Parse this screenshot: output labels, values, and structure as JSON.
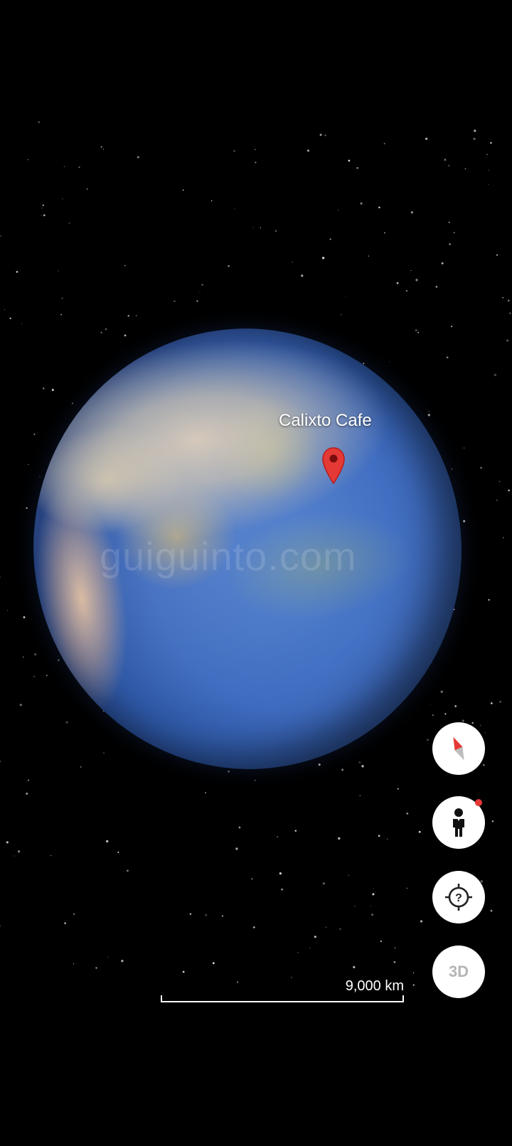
{
  "map": {
    "place_label": "Calixto Cafe",
    "watermark": "guiguinto.com",
    "scale_label": "9,000 km"
  },
  "controls": {
    "compass_icon": "compass-icon",
    "streetview_icon": "pegman-icon",
    "mylocation_icon": "my-location-icon",
    "view_mode_label": "3D",
    "streetview_badge_color": "#e53935"
  },
  "colors": {
    "pin": "#e53935",
    "space": "#000000",
    "ocean": "#3f6cc0"
  }
}
